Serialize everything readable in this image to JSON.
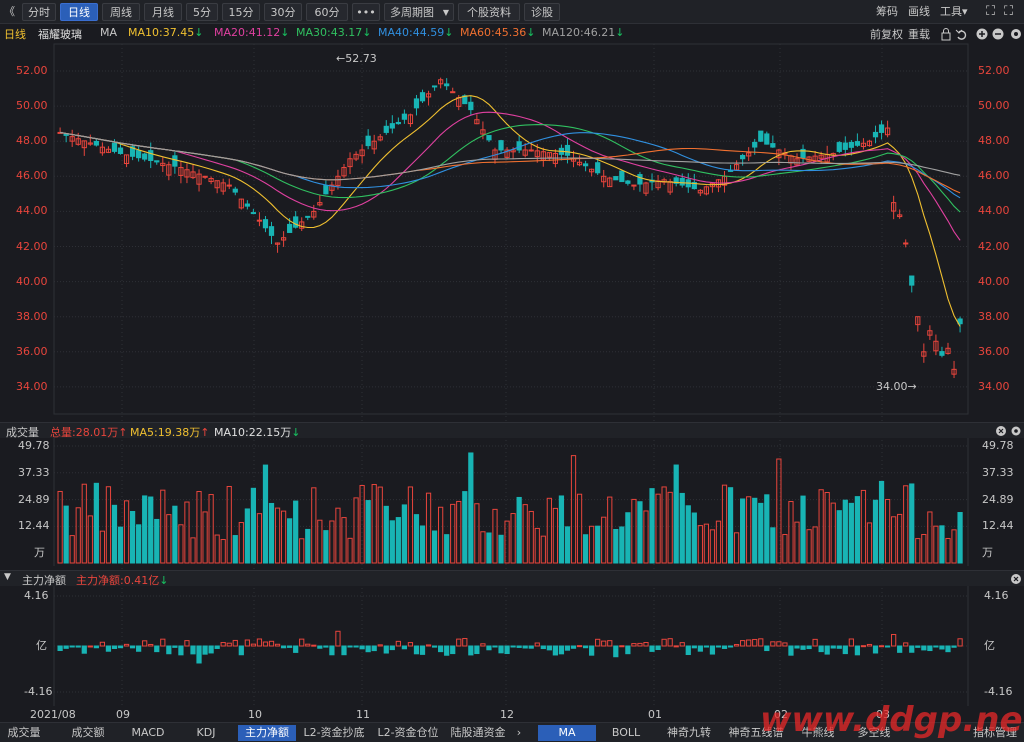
{
  "toolbar": {
    "back_glyph": "《",
    "periods": [
      "分时",
      "日线",
      "周线",
      "月线",
      "5分",
      "15分",
      "30分",
      "60分"
    ],
    "active_period": "日线",
    "more": "•••",
    "multi": "多周期图",
    "multi_arrow": "▼",
    "info": "个股资料",
    "diag": "诊股",
    "right": [
      "筹码",
      "画线",
      "工具"
    ],
    "tools_arrow": "▾",
    "expand_glyph": "⛶"
  },
  "pricebar": {
    "period": "日线",
    "stock": "福耀玻璃",
    "ma_label": "MA",
    "ma": [
      {
        "text": "MA10:37.45",
        "color": "#f0c030",
        "arrow": "↓"
      },
      {
        "text": "MA20:41.12",
        "color": "#e040a0",
        "arrow": "↓"
      },
      {
        "text": "MA30:43.17",
        "color": "#30c060",
        "arrow": "↓"
      },
      {
        "text": "MA40:44.59",
        "color": "#3090e0",
        "arrow": "↓"
      },
      {
        "text": "MA60:45.36",
        "color": "#f07030",
        "arrow": "↓"
      },
      {
        "text": "MA120:46.21",
        "color": "#a0a0a0",
        "arrow": "↓"
      }
    ],
    "adj": "前复权",
    "rights": "重载",
    "icons": [
      "lock-icon",
      "undo-icon",
      "zoom-in-icon",
      "zoom-out-icon",
      "settings-icon"
    ]
  },
  "price_axis": [
    "52.00",
    "50.00",
    "48.00",
    "46.00",
    "44.00",
    "42.00",
    "40.00",
    "38.00",
    "36.00",
    "34.00"
  ],
  "annotations": {
    "high": "←52.73",
    "low": "34.00→"
  },
  "volume": {
    "title": "成交量",
    "total": "总量:28.01万",
    "total_arrow": "↑",
    "ma5": "MA5:19.38万",
    "ma5_arrow": "↑",
    "ma10": "MA10:22.15万",
    "ma10_arrow": "↓",
    "axis": [
      "49.78",
      "37.33",
      "24.89",
      "12.44",
      "万"
    ]
  },
  "flow": {
    "title": "主力净额",
    "value": "主力净额:0.41亿",
    "value_arrow": "↓",
    "axis": [
      "4.16",
      "亿",
      "-4.16"
    ]
  },
  "x_axis": [
    "2021/08",
    "09",
    "10",
    "11",
    "12",
    "01",
    "02",
    "03"
  ],
  "bottom_tabs": [
    "成交量",
    "成交额",
    "MACD",
    "KDJ",
    "主力净额",
    "L2-资金抄底",
    "L2-资金仓位",
    "陆股通资金"
  ],
  "active_bottom": "主力净额",
  "bottom_tabs2": [
    "MA",
    "BOLL",
    "神奇九转",
    "神奇五线谱",
    "牛熊线",
    "多空线",
    "指标管理"
  ],
  "active_bottom2": "MA",
  "watermark": "www.ddgp.net",
  "colors": {
    "up": "#e8453c",
    "down": "#18b4b4",
    "bg": "#1a1b20",
    "grid": "#2e3036"
  }
}
